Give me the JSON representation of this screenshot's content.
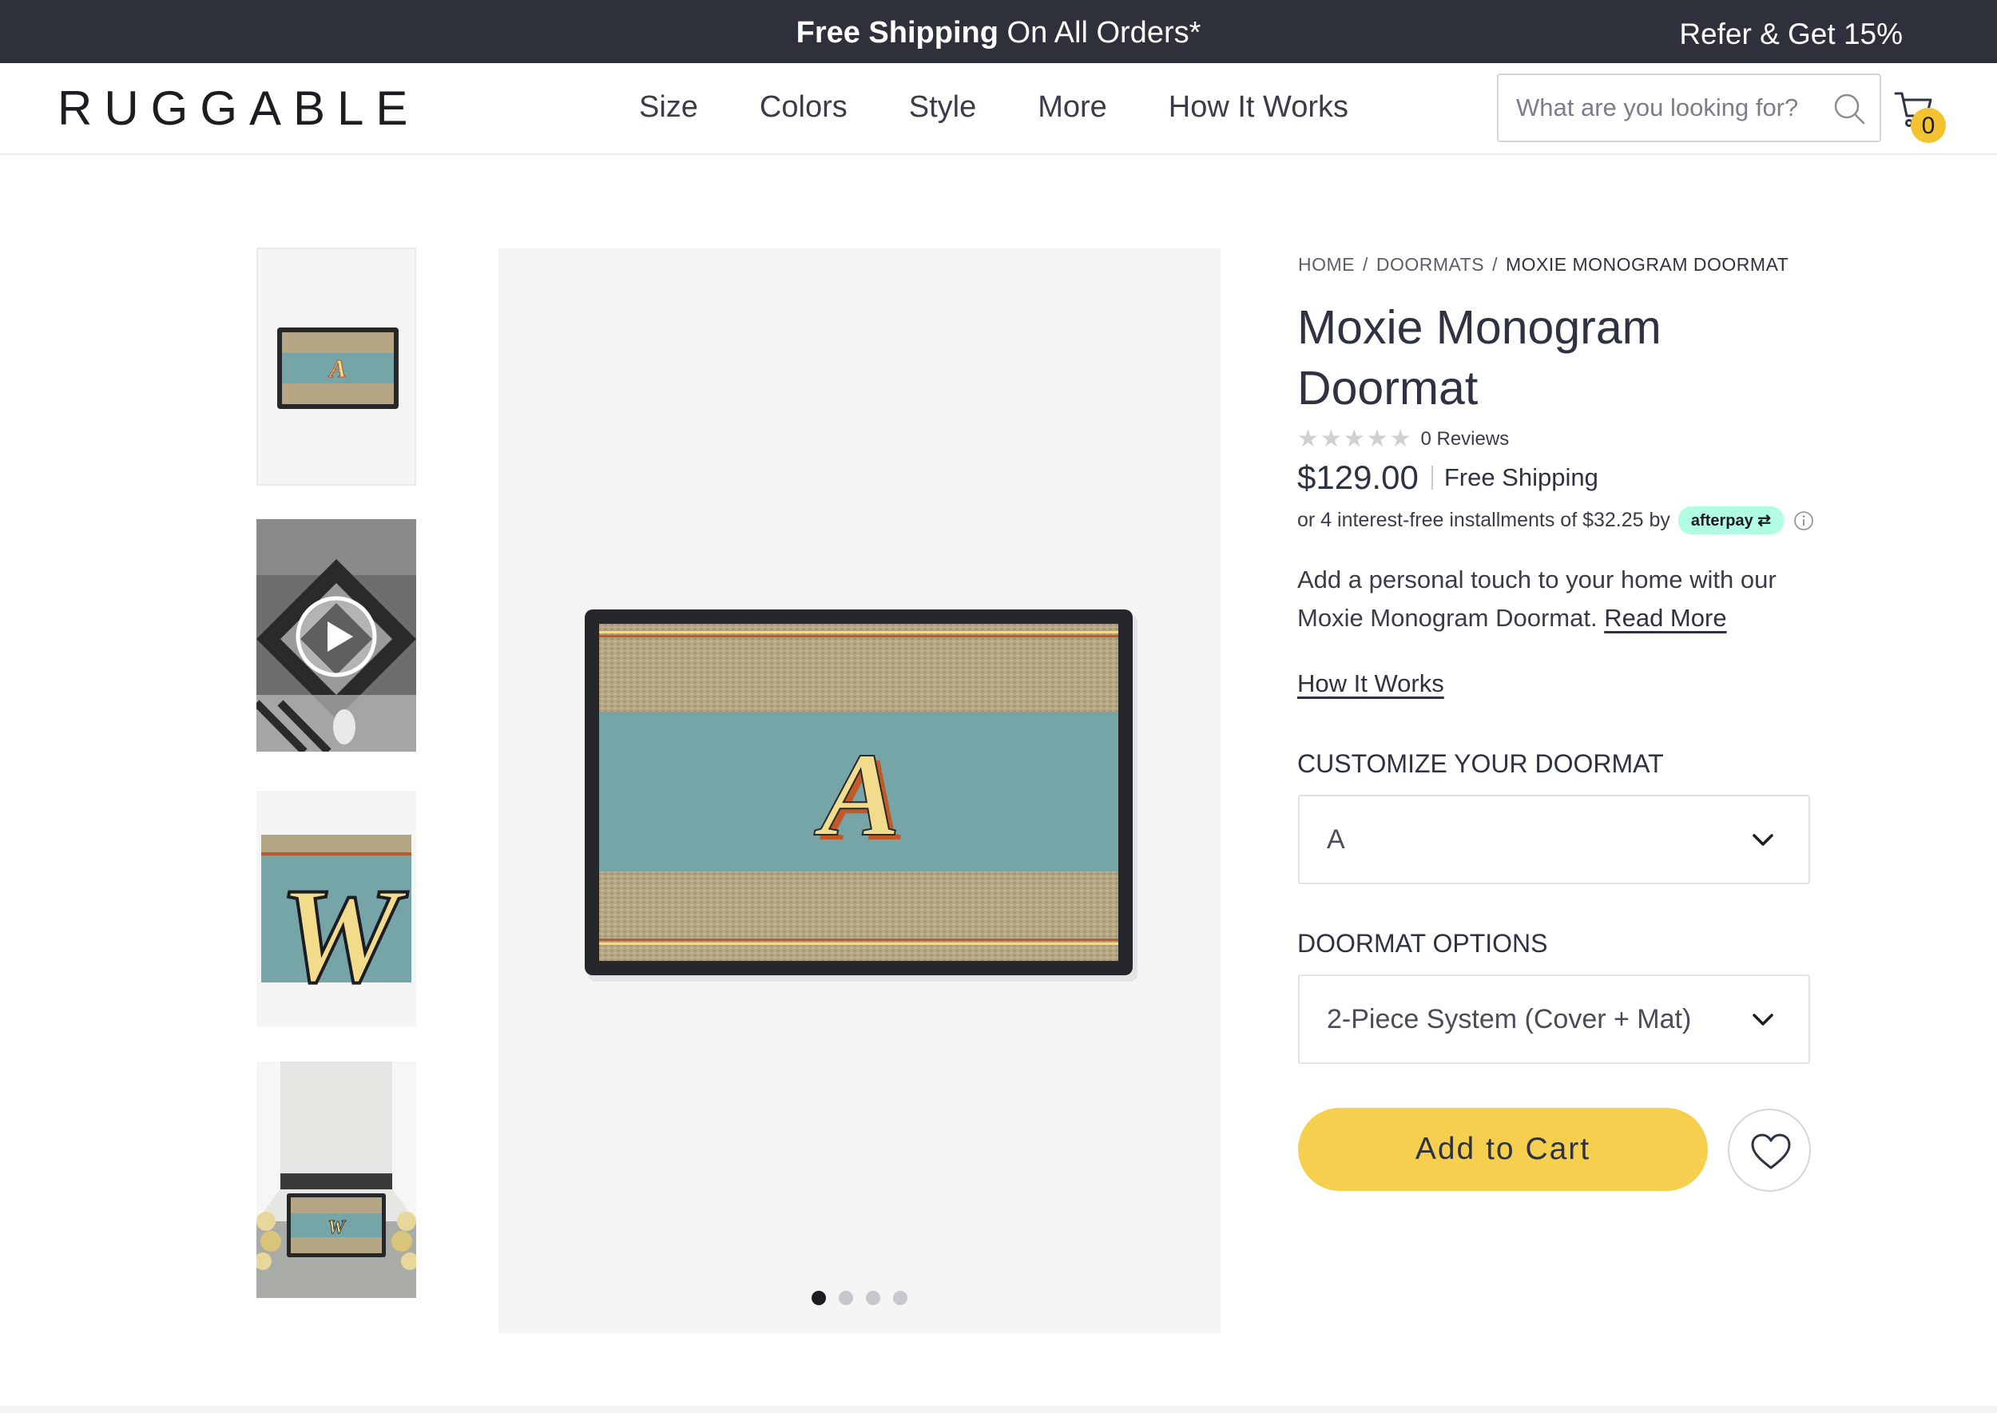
{
  "promo": {
    "bold": "Free Shipping",
    "rest": " On All Orders*",
    "refer": "Refer & Get 15%"
  },
  "header": {
    "logo": "RUGGABLE",
    "nav": [
      "Size",
      "Colors",
      "Style",
      "More",
      "How It Works"
    ],
    "search_placeholder": "What are you looking for?",
    "cart_count": "0"
  },
  "gallery": {
    "thumbnails": [
      {
        "letter": "A",
        "kind": "doormat"
      },
      {
        "letter": "",
        "kind": "video",
        "icon": "play-icon"
      },
      {
        "letter": "W",
        "kind": "closeup"
      },
      {
        "letter": "W",
        "kind": "room"
      }
    ],
    "main_letter": "A",
    "active_slide": 1,
    "slide_count": 4
  },
  "product": {
    "breadcrumb": [
      "HOME",
      "DOORMATS",
      "MOXIE MONOGRAM DOORMAT"
    ],
    "breadcrumb_sep": "/",
    "title": "Moxie Monogram Doormat",
    "rating_stars": 0,
    "reviews": "0 Reviews",
    "price": "$129.00",
    "shipping": "Free Shipping",
    "installments": "or 4 interest-free installments of $32.25 by",
    "afterpay": "afterpay",
    "description": "Add a personal touch to your home with our Moxie Monogram Doormat.",
    "read_more": "Read More",
    "how_it_works": "How It Works",
    "customize_label": "CUSTOMIZE YOUR DOORMAT",
    "customize_value": "A",
    "options_label": "DOORMAT OPTIONS",
    "options_value": "2-Piece System (Cover + Mat)",
    "add_to_cart": "Add to Cart"
  },
  "colors": {
    "promo_bg": "#2e313b",
    "button_yellow": "#f6cf4e",
    "mat_teal": "#76a5a8",
    "mat_tan": "#b4a584",
    "mat_border": "#25272b"
  }
}
